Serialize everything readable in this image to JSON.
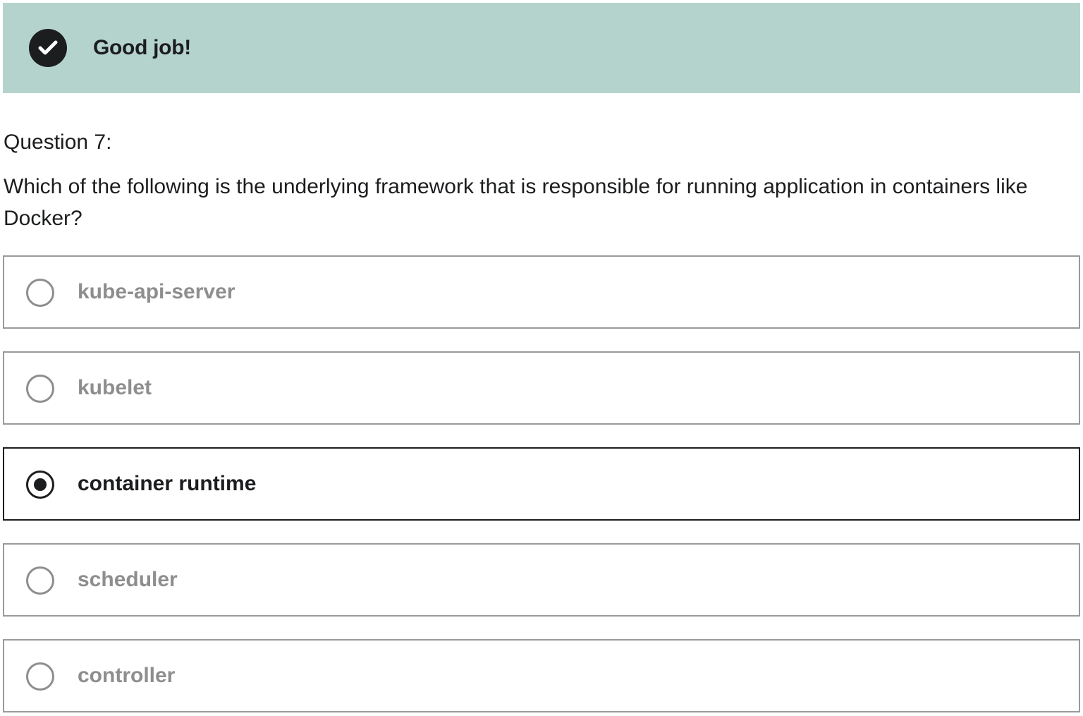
{
  "banner": {
    "title": "Good job!",
    "icon": "check-circle-icon",
    "background_color": "#b5d3cd"
  },
  "question": {
    "label": "Question 7:",
    "text": "Which of the following is the underlying framework that is responsible for running application in containers like Docker?"
  },
  "options": [
    {
      "label": "kube-api-server",
      "selected": false
    },
    {
      "label": "kubelet",
      "selected": false
    },
    {
      "label": "container runtime",
      "selected": true
    },
    {
      "label": "scheduler",
      "selected": false
    },
    {
      "label": "controller",
      "selected": false
    }
  ],
  "colors": {
    "text": "#1c1d1f",
    "muted": "#8e8e8e",
    "border": "#9a9a9a"
  }
}
